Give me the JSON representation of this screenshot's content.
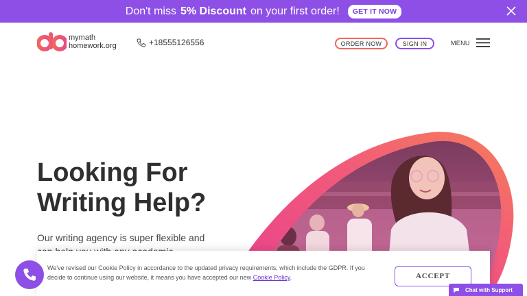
{
  "promo": {
    "lead": "Don't miss",
    "highlight": "5% Discount",
    "tail": "on your first order!",
    "cta": "GET IT NOW"
  },
  "header": {
    "logo_mark": "do",
    "logo_line1": "mymath",
    "logo_line2": "homework.org",
    "phone": "+18555126556",
    "order_label": "ORDER NOW",
    "signin_label": "SIGN IN",
    "menu_label": "MENU"
  },
  "hero": {
    "title_line1": "Looking For",
    "title_line2": "Writing Help?",
    "subtitle": "Our writing agency is super flexible and can help you with any academic"
  },
  "cookie": {
    "text_pre": "We've revised our Cookie Policy in accordance to the updated privacy requirements, which include the GDPR. If you decide to continue using our website, it means you have accepted our new",
    "link": "Cookie Policy",
    "text_post": ".",
    "accept": "ACCEPT"
  },
  "chat": {
    "label": "Chat with Support"
  },
  "colors": {
    "brand_purple": "#8d4fe6",
    "brand_coral": "#f0665e"
  }
}
